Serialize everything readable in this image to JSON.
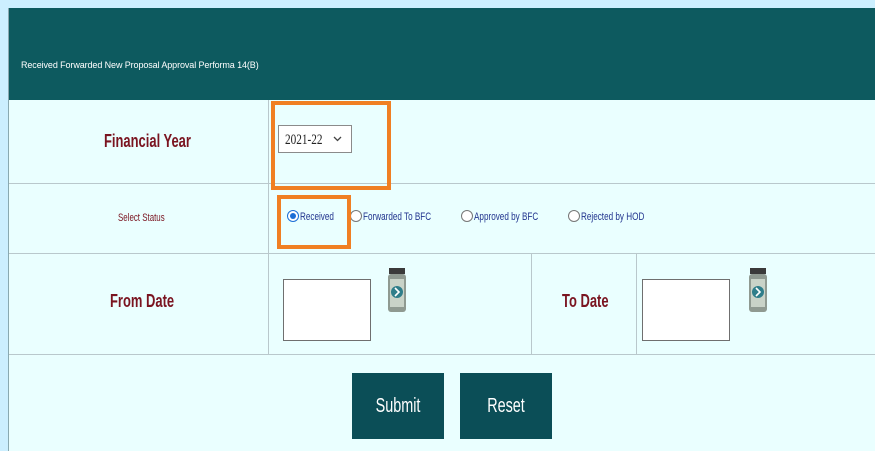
{
  "header": {
    "title": "Received Forwarded New Proposal Approval Performa 14(B)"
  },
  "financial_year": {
    "label": "Financial Year",
    "selected": "2021-22"
  },
  "status": {
    "label": "Select Status",
    "options": [
      {
        "label": "Received",
        "checked": true
      },
      {
        "label": "Forwarded To BFC",
        "checked": false
      },
      {
        "label": "Approved by BFC",
        "checked": false
      },
      {
        "label": "Rejected by HOD",
        "checked": false
      }
    ]
  },
  "from_date": {
    "label": "From Date",
    "value": ""
  },
  "to_date": {
    "label": "To Date",
    "value": ""
  },
  "buttons": {
    "submit": "Submit",
    "reset": "Reset"
  },
  "colors": {
    "header_bg": "#0d5a5f",
    "panel_bg": "#eaffff",
    "label_text": "#7a1420",
    "highlight": "#f07f23",
    "button_bg": "#0b4e57"
  }
}
